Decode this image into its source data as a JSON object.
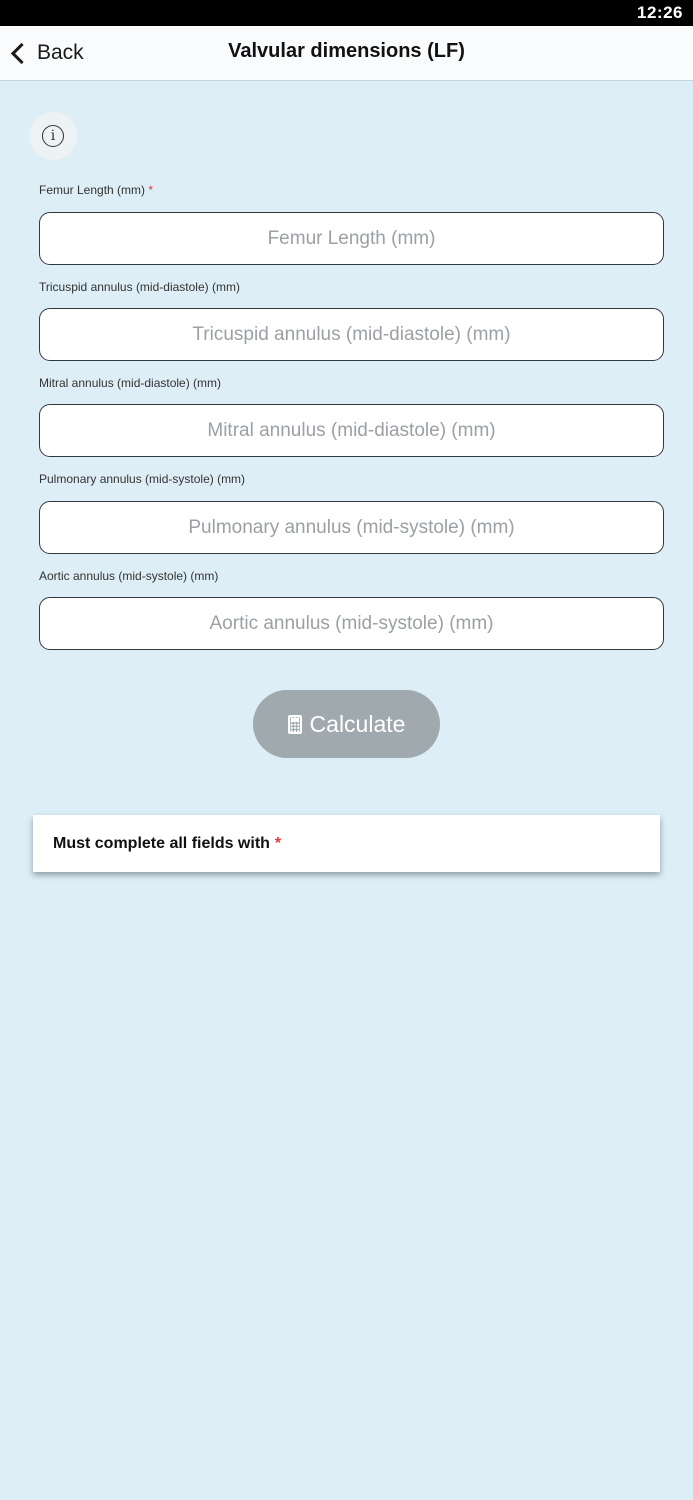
{
  "status_bar": {
    "time": "12:26"
  },
  "header": {
    "back_label": "Back",
    "title": "Valvular dimensions (LF)"
  },
  "form": {
    "fields": [
      {
        "label": "Femur Length (mm)",
        "required_mark": "*",
        "value": "",
        "placeholder": "Femur Length (mm)"
      },
      {
        "label": "Tricuspid annulus (mid-diastole) (mm)",
        "value": "",
        "placeholder": "Tricuspid annulus (mid-diastole) (mm)"
      },
      {
        "label": "Mitral annulus (mid-diastole) (mm)",
        "value": "",
        "placeholder": "Mitral annulus (mid-diastole) (mm)"
      },
      {
        "label": "Pulmonary annulus (mid-systole) (mm)",
        "value": "",
        "placeholder": "Pulmonary annulus (mid-systole) (mm)"
      },
      {
        "label": "Aortic annulus (mid-systole) (mm)",
        "value": "",
        "placeholder": "Aortic annulus (mid-systole) (mm)"
      }
    ],
    "calculate_label": "Calculate",
    "calculate_icon": "calculator-icon",
    "info_icon": "info-icon"
  },
  "notice": {
    "text": "Must complete all fields with",
    "star": "*"
  },
  "colors": {
    "background": "#ddeef7",
    "header": "#fafbfc",
    "button_disabled": "#a0aaae",
    "required": "#d33c3c"
  }
}
